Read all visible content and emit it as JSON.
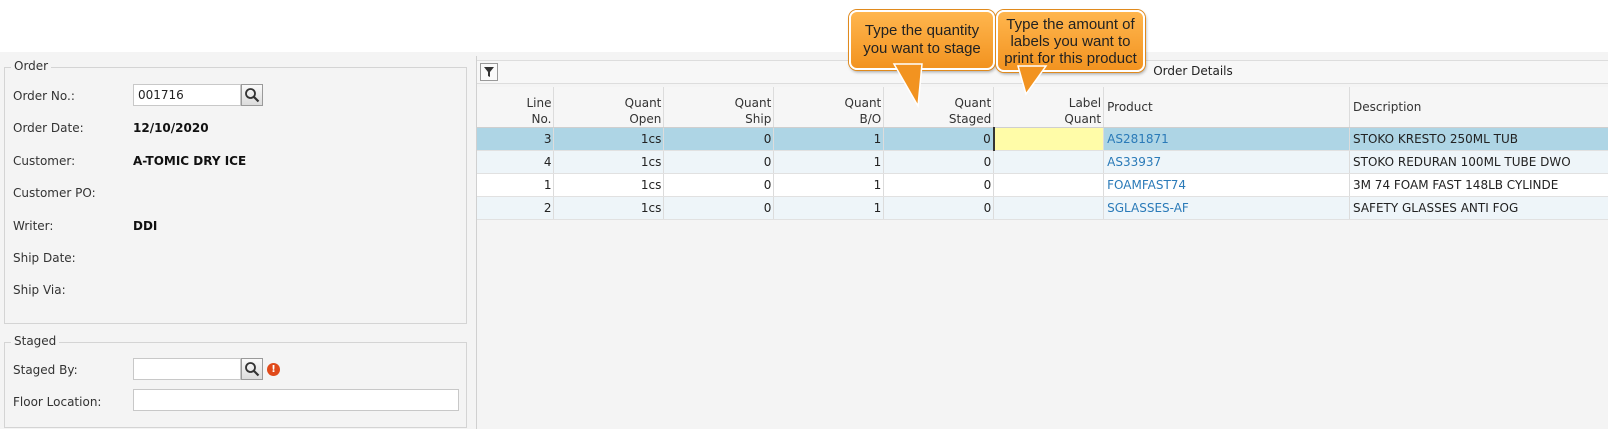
{
  "order": {
    "section_title": "Order",
    "order_no_label": "Order No.:",
    "order_no_value": "001716",
    "order_date_label": "Order Date:",
    "order_date_value": "12/10/2020",
    "customer_label": "Customer:",
    "customer_value": "A-TOMIC DRY ICE",
    "customer_po_label": "Customer PO:",
    "writer_label": "Writer:",
    "writer_value": "DDI",
    "ship_date_label": "Ship Date:",
    "ship_via_label": "Ship Via:"
  },
  "staged": {
    "section_title": "Staged",
    "staged_by_label": "Staged By:",
    "staged_by_value": "",
    "floor_location_label": "Floor Location:",
    "floor_location_value": ""
  },
  "grid": {
    "title": "Order Details",
    "columns": [
      {
        "line1": "Line",
        "line2": "No."
      },
      {
        "line1": "Quant",
        "line2": "Open"
      },
      {
        "line1": "Quant",
        "line2": "Ship"
      },
      {
        "line1": "Quant",
        "line2": "B/O"
      },
      {
        "line1": "Quant",
        "line2": "Staged"
      },
      {
        "line1": "Label",
        "line2": "Quant"
      },
      {
        "line1": "Product",
        "line2": ""
      },
      {
        "line1": "Description",
        "line2": ""
      }
    ],
    "rows": [
      {
        "line": "3",
        "open": "1cs",
        "ship": "0",
        "bo": "1",
        "staged": "0",
        "label_quant": "",
        "product": "AS281871",
        "description": "STOKO KRESTO 250ML TUB"
      },
      {
        "line": "4",
        "open": "1cs",
        "ship": "0",
        "bo": "1",
        "staged": "0",
        "label_quant": "",
        "product": "AS33937",
        "description": "STOKO REDURAN 100ML TUBE DWO"
      },
      {
        "line": "1",
        "open": "1cs",
        "ship": "0",
        "bo": "1",
        "staged": "0",
        "label_quant": "",
        "product": "FOAMFAST74",
        "description": "3M 74 FOAM FAST 148LB CYLINDE"
      },
      {
        "line": "2",
        "open": "1cs",
        "ship": "0",
        "bo": "1",
        "staged": "0",
        "label_quant": "",
        "product": "SGLASSES-AF",
        "description": "SAFETY GLASSES ANTI FOG"
      }
    ]
  },
  "callouts": {
    "stage_tip_line1": "Type the quantity",
    "stage_tip_line2": "you want to stage",
    "label_tip_line1": "Type the amount of",
    "label_tip_line2": "labels you want to",
    "label_tip_line3": "print for this product"
  },
  "colors": {
    "selected_row": "#aed5e5",
    "editing_cell": "#fffca8",
    "link": "#2a7ab8",
    "callout": "#f29320",
    "warning": "#e04a1a"
  }
}
